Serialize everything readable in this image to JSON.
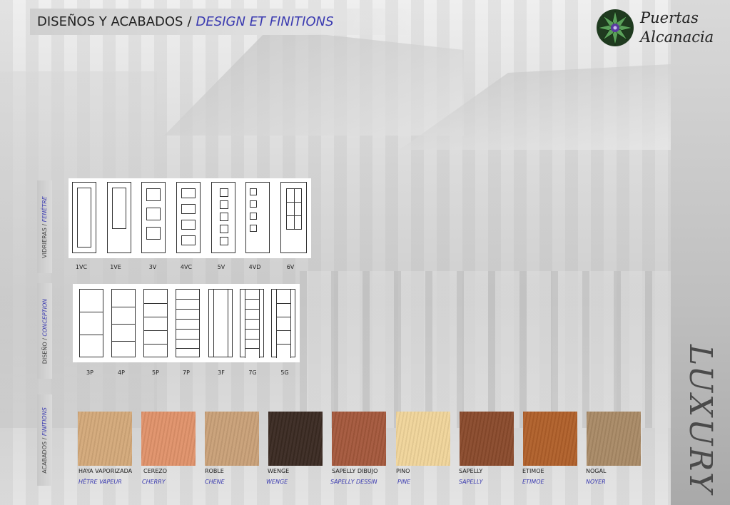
{
  "header": {
    "title_es": "DISEÑOS Y ACABADOS",
    "separator": "/",
    "title_fr": "DESIGN ET FINITIONS"
  },
  "logo": {
    "icon": "star-mosaic-logo-icon",
    "line1": "Puertas",
    "line2": "Alcanacia"
  },
  "collection": "LUXURY",
  "sections": {
    "glass": {
      "es": "VIDRIERAS",
      "sep": " / ",
      "fr": "FENÊTRE"
    },
    "design": {
      "es": "DISEÑO",
      "sep": " / ",
      "fr": "CONCEPTION"
    },
    "finish": {
      "es": "ACABADOS",
      "sep": " / ",
      "fr": "FINITIONS"
    }
  },
  "glass_models": [
    {
      "code": "1VC"
    },
    {
      "code": "1VE"
    },
    {
      "code": "3V"
    },
    {
      "code": "4VC"
    },
    {
      "code": "5V"
    },
    {
      "code": "4VD"
    },
    {
      "code": "6V"
    }
  ],
  "design_models": [
    {
      "code": "3P"
    },
    {
      "code": "4P"
    },
    {
      "code": "5P"
    },
    {
      "code": "7P"
    },
    {
      "code": "3F"
    },
    {
      "code": "7G"
    },
    {
      "code": "5G"
    }
  ],
  "finishes": [
    {
      "es": "HAYA VAPORIZADA",
      "fr": "HÊTRE VAPEUR",
      "color": "#d3a97a"
    },
    {
      "es": "CEREZO",
      "fr": "CHERRY",
      "color": "#e0926a"
    },
    {
      "es": "ROBLE",
      "fr": "CHENE",
      "color": "#c9a078"
    },
    {
      "es": "WENGE",
      "fr": "WENGE",
      "color": "#3a2a22"
    },
    {
      "es": "SAPELLY DIBUJO",
      "fr": "SAPELLY DESSIN",
      "color": "#a4583c"
    },
    {
      "es": "PINO",
      "fr": "PINE",
      "color": "#f0d49a"
    },
    {
      "es": "SAPELLY",
      "fr": "SAPELLY",
      "color": "#8a4a2c"
    },
    {
      "es": "ETIMOE",
      "fr": "ETIMOE",
      "color": "#b0602a"
    },
    {
      "es": "NOGAL",
      "fr": "NOYER",
      "color": "#a98a66"
    }
  ]
}
